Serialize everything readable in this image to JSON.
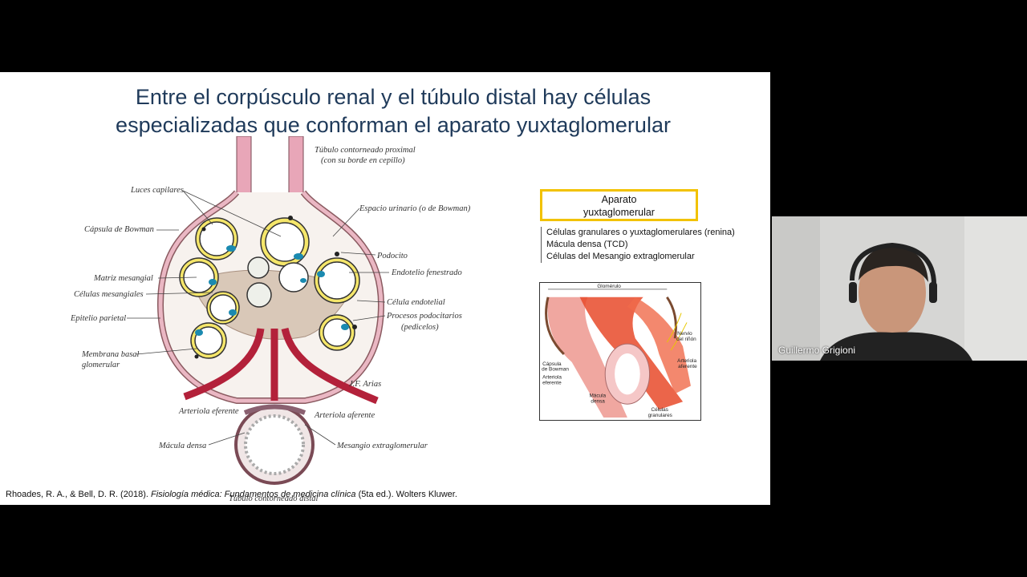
{
  "slide": {
    "title_line1": "Entre el corpúsculo renal y el túbulo distal hay células",
    "title_line2": "especializadas que conforman el aparato yuxtaglomerular",
    "main_figure_labels": {
      "tubulo_proximal_1": "Túbulo contorneado proximal",
      "tubulo_proximal_2": "(con su borde en cepillo)",
      "luces_capilares": "Luces capilares",
      "espacio_urinario": "Espacio urinario (o de Bowman)",
      "capsula_bowman": "Cápsula de Bowman",
      "podocito": "Podocito",
      "endotelio": "Endotelio fenestrado",
      "matriz": "Matriz mesangial",
      "celulas_mesangiales": "Células mesangiales",
      "celula_endotelial": "Célula endotelial",
      "procesos_1": "Procesos podocitarios",
      "procesos_2": "(pedicelos)",
      "epitelio": "Epitelio parietal",
      "membrana_1": "Membrana basal",
      "membrana_2": "glomerular",
      "arteriola_eferente": "Arteriola eferente",
      "arteriola_aferente": "Arteriola aferente",
      "macula_densa": "Mácula densa",
      "mesangio_extra": "Mesangio extraglomerular",
      "tubulo_distal": "Túbulo contorneado distal",
      "signature": "J.F. Arias"
    },
    "aparato_line1": "Aparato",
    "aparato_line2": "yuxtaglomerular",
    "cells_list": [
      "Células granulares o yuxtaglomerulares (renina)",
      "Mácula densa (TCD)",
      "Células del Mesangio extraglomerular"
    ],
    "small_figure_labels": {
      "glomerulo": "Glomérulo",
      "nervio_1": "Nervio",
      "nervio_2": "del riñón",
      "arteriola_aferente_1": "Arteriola",
      "arteriola_aferente_2": "aferente",
      "capsula_1": "Cápsula",
      "capsula_2": "de Bowman",
      "arteriola_eferente_1": "Arteriola",
      "arteriola_eferente_2": "eferente",
      "macula_1": "Mácula",
      "macula_2": "densa",
      "granulares_1": "Células",
      "granulares_2": "granulares"
    },
    "reference_pre": "Rhoades, R. A., & Bell, D. R. (2018). ",
    "reference_italic": "Fisiología médica: Fundamentos de medicina clínica",
    "reference_post": " (5ta ed.). Wolters Kluwer."
  },
  "webcam": {
    "participant_name": "Guillermo Grigioni"
  },
  "colors": {
    "title": "#1f3a5a",
    "highlight_box": "#f2c200",
    "vessel": "#b3213a",
    "podocyte": "#f5e66a",
    "nucleus": "#1a8ab0"
  }
}
